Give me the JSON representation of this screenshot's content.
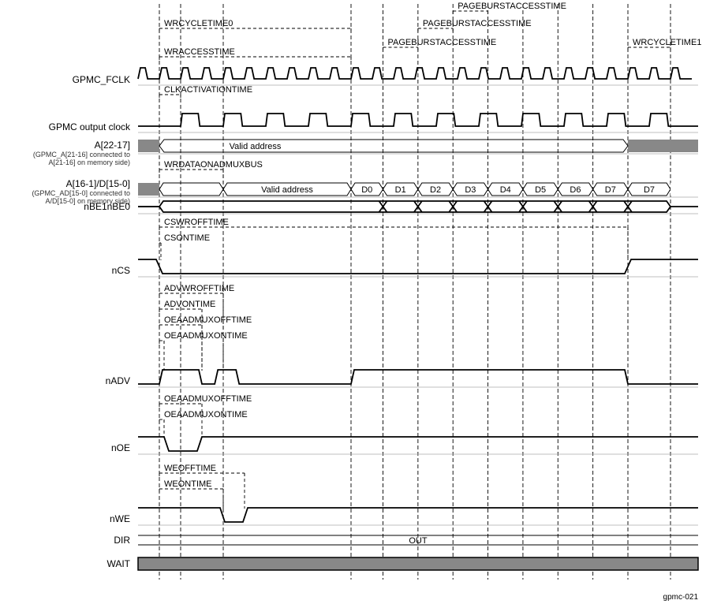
{
  "chart_data": {
    "type": "timing-diagram",
    "signals": [
      "GPMC_FCLK",
      "GPMC output clock",
      "A[22-17]",
      "A[16-1]/D[15-0]",
      "nBE1nBE0",
      "nCS",
      "nADV",
      "nOE",
      "nWE",
      "DIR",
      "WAIT"
    ]
  },
  "labels": {
    "gpmc_fclk": "GPMC_FCLK",
    "gpmc_outclk": "GPMC output clock",
    "a_hi": "A[22-17]",
    "a_hi_sub1": "(GPMC_A[21-16] connected to",
    "a_hi_sub2": "A[21-16] on memory side)",
    "a_lo": "A[16-1]/D[15-0]",
    "a_lo_sub1": "(GPMC_AD[15-0] connected to",
    "a_lo_sub2": "A/D[15-0] on memory side)",
    "nbe": "nBE1nBE0",
    "ncs": "nCS",
    "nadv": "nADV",
    "noe": "nOE",
    "nwe": "nWE",
    "dir": "DIR",
    "wait": "WAIT",
    "valid_addr": "Valid address",
    "out": "OUT",
    "d0": "D0",
    "d1": "D1",
    "d2": "D2",
    "d3": "D3",
    "d4": "D4",
    "d5": "D5",
    "d6": "D6",
    "d7": "D7"
  },
  "params": {
    "wrcycletime0": "WRCYCLETIME0",
    "wraccesstime": "WRACCESSTIME",
    "clkactivationtime": "CLKACTIVATIONTIME",
    "pageburst3": "PAGEBURSTACCESSTIME",
    "pageburst2": "PAGEBURSTACCESSTIME",
    "pageburst1": "PAGEBURSTACCESSTIME",
    "wrcycletime1": "WRCYCLETIME1",
    "wrdataonadmuxbus": "WRDATAONADMUXBUS",
    "cswrofftime": "CSWROFFTIME",
    "csontime": "CSONTIME",
    "advwrofftime": "ADVWROFFTIME",
    "advontime": "ADVONTIME",
    "oeaadmuxofftime": "OEAADMUXOFFTIME",
    "oeaadmuxontime": "OEAADMUXONTIME",
    "oeaadmuxofftime2": "OEAADMUXOFFTIME",
    "oeaadmuxontime2": "OEAADMUXONTIME",
    "weofftime": "WEOFFTIME",
    "weontime": "WEONTIME"
  },
  "footer": "gpmc-021"
}
